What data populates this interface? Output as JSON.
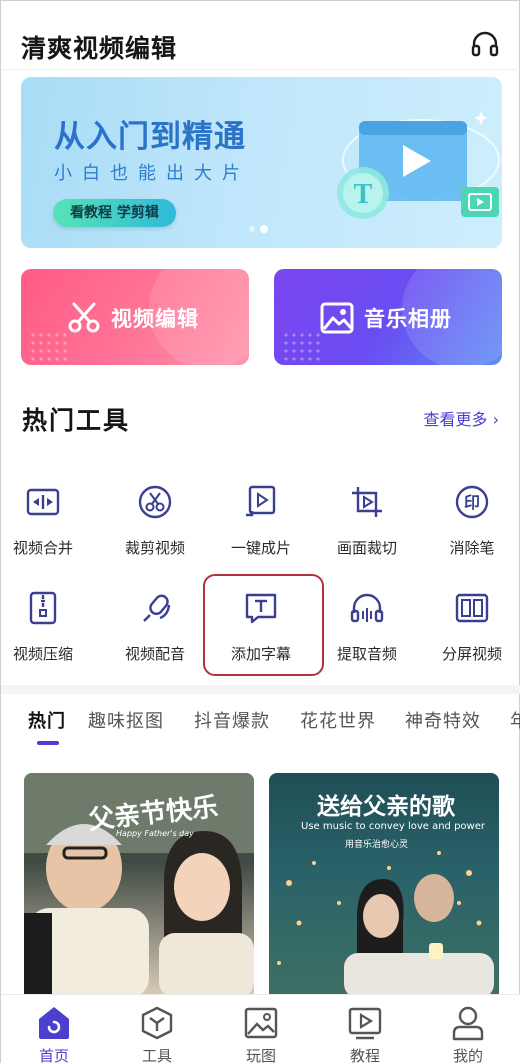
{
  "header": {
    "title": "清爽视频编辑",
    "support_icon": "headset-icon"
  },
  "banner": {
    "title": "从入门到精通",
    "subtitle": "小白也能出大片",
    "button_label": "看教程 学剪辑",
    "art_letter": "T",
    "page_count": 2,
    "active_page": 2
  },
  "big_cards": [
    {
      "label": "视频编辑",
      "icon": "scissors-icon",
      "color": "#ff6690"
    },
    {
      "label": "音乐相册",
      "icon": "image-icon",
      "color": "#6d4cf0"
    }
  ],
  "hot_tools": {
    "title": "热门工具",
    "more_label": "查看更多",
    "items": [
      {
        "label": "视频合并",
        "icon": "merge-icon"
      },
      {
        "label": "裁剪视频",
        "icon": "cut-icon"
      },
      {
        "label": "一键成片",
        "icon": "one-click-icon"
      },
      {
        "label": "画面裁切",
        "icon": "crop-icon"
      },
      {
        "label": "消除笔",
        "icon": "eraser-icon"
      },
      {
        "label": "视频压缩",
        "icon": "compress-icon"
      },
      {
        "label": "视频配音",
        "icon": "dubbing-icon"
      },
      {
        "label": "添加字幕",
        "icon": "subtitle-icon"
      },
      {
        "label": "提取音频",
        "icon": "audio-extract-icon"
      },
      {
        "label": "分屏视频",
        "icon": "split-screen-icon"
      }
    ]
  },
  "category_tabs": [
    "热门",
    "趣味抠图",
    "抖音爆款",
    "花花世界",
    "神奇特效",
    "年"
  ],
  "thumbnails": [
    {
      "caption": "父亲节快乐",
      "caption_small": "Happy Father's day"
    },
    {
      "caption": "送给父亲的歌",
      "caption_small": "Use music to convey love and power",
      "caption_small2": "用音乐治愈心灵"
    }
  ],
  "bottom_nav": [
    {
      "label": "首页",
      "icon": "home-icon",
      "active": true
    },
    {
      "label": "工具",
      "icon": "cube-icon",
      "active": false
    },
    {
      "label": "玩图",
      "icon": "picture-icon",
      "active": false
    },
    {
      "label": "教程",
      "icon": "video-tutorial-icon",
      "active": false
    },
    {
      "label": "我的",
      "icon": "user-icon",
      "active": false
    }
  ],
  "colors": {
    "accent": "#4a3fcf",
    "tool_icon": "#3b3f8f",
    "highlight": "#b5323a"
  }
}
